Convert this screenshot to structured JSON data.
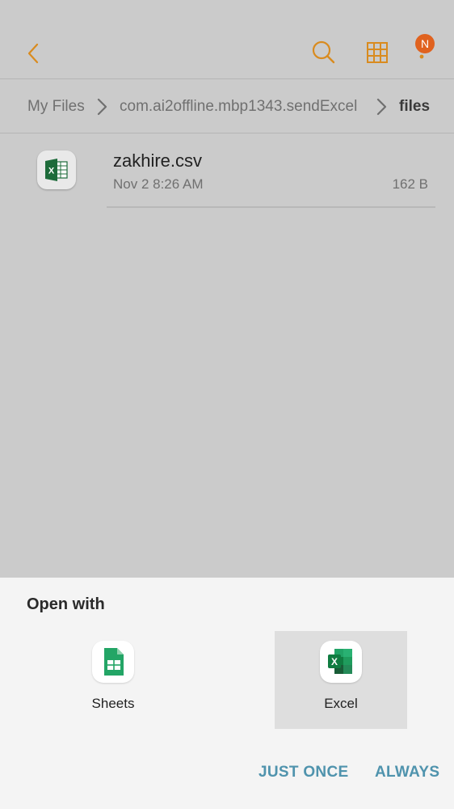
{
  "colors": {
    "accent": "#d98b1f",
    "badge": "#e0621f",
    "action": "#4f93ad",
    "background": "#cbcbcb"
  },
  "toolbar": {
    "back_icon": "chevron-left-icon",
    "search_icon": "search-icon",
    "grid_icon": "grid-view-icon",
    "more_icon": "more-vertical-icon",
    "badge_letter": "N"
  },
  "breadcrumb": {
    "items": [
      "My Files",
      "com.ai2offline.mbp1343.sendExcel",
      "files"
    ]
  },
  "files": [
    {
      "name": "zakhire.csv",
      "date": "Nov 2 8:26 AM",
      "size": "162 B",
      "icon": "excel-file-icon"
    }
  ],
  "open_with": {
    "title": "Open with",
    "apps": [
      {
        "label": "Sheets",
        "icon": "google-sheets-icon",
        "selected": false
      },
      {
        "label": "Excel",
        "icon": "excel-icon",
        "selected": true
      }
    ],
    "actions": {
      "just_once": "JUST ONCE",
      "always": "ALWAYS"
    }
  }
}
